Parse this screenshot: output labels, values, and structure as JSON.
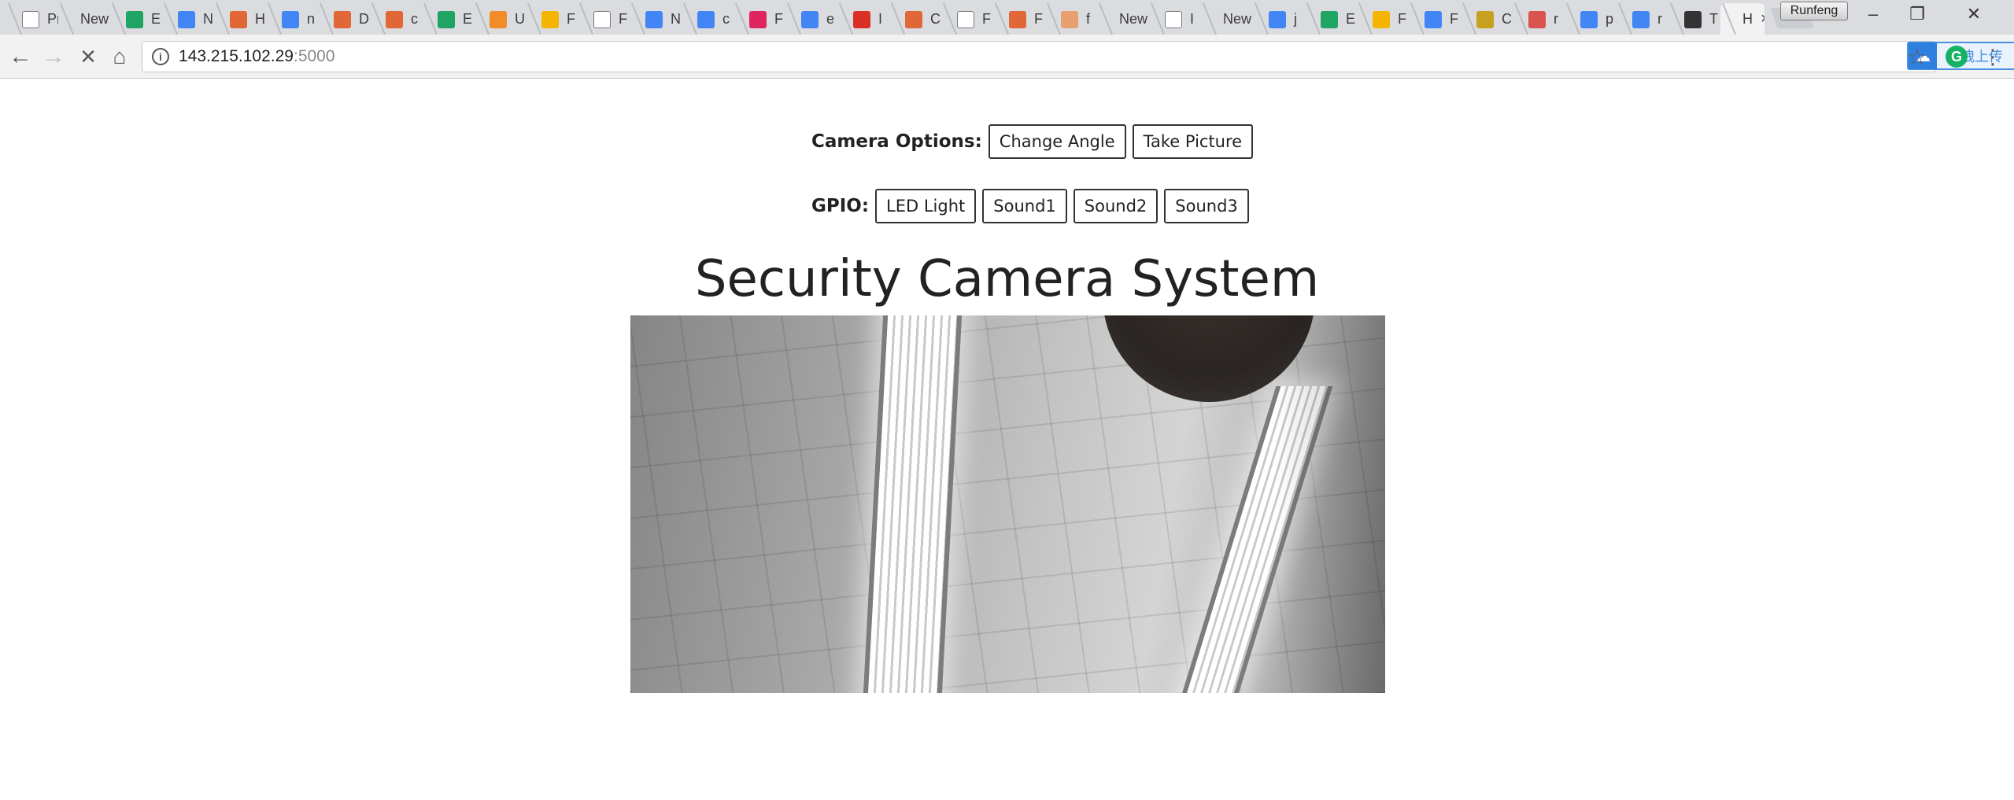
{
  "browser": {
    "tabs": [
      {
        "label": "Priva",
        "icon": "document-icon",
        "color": ""
      },
      {
        "label": "New",
        "icon": "",
        "color": ""
      },
      {
        "label": "E",
        "icon": "google-drive-icon",
        "color": "#1fa463"
      },
      {
        "label": "N",
        "icon": "google-docs-icon",
        "color": "#4285f4"
      },
      {
        "label": "H",
        "icon": "matlab-icon",
        "color": "#e16737"
      },
      {
        "label": "n",
        "icon": "google-icon",
        "color": "#4285f4"
      },
      {
        "label": "D",
        "icon": "matlab-icon",
        "color": "#e16737"
      },
      {
        "label": "c",
        "icon": "matlab-icon",
        "color": "#e16737"
      },
      {
        "label": "E",
        "icon": "google-drive-icon",
        "color": "#1fa463"
      },
      {
        "label": "U",
        "icon": "diagram-icon",
        "color": "#f28c28"
      },
      {
        "label": "F",
        "icon": "google-slides-icon",
        "color": "#f4b400"
      },
      {
        "label": "F",
        "icon": "document-icon",
        "color": ""
      },
      {
        "label": "N",
        "icon": "google-docs-icon",
        "color": "#4285f4"
      },
      {
        "label": "c",
        "icon": "google-icon",
        "color": "#4285f4"
      },
      {
        "label": "F",
        "icon": "heart-icon",
        "color": "#e0245e"
      },
      {
        "label": "e",
        "icon": "google-icon",
        "color": "#4285f4"
      },
      {
        "label": "I",
        "icon": "gmail-icon",
        "color": "#d93025"
      },
      {
        "label": "C",
        "icon": "matlab-icon",
        "color": "#e16737"
      },
      {
        "label": "F",
        "icon": "document-icon",
        "color": ""
      },
      {
        "label": "F",
        "icon": "matlab-icon",
        "color": "#e16737"
      },
      {
        "label": "f",
        "icon": "hand-icon",
        "color": "#e8a070"
      },
      {
        "label": "New",
        "icon": "",
        "color": ""
      },
      {
        "label": "I",
        "icon": "document-icon",
        "color": ""
      },
      {
        "label": "New",
        "icon": "",
        "color": ""
      },
      {
        "label": "j",
        "icon": "google-icon",
        "color": "#4285f4"
      },
      {
        "label": "E",
        "icon": "google-drive-icon",
        "color": "#1fa463"
      },
      {
        "label": "F",
        "icon": "google-slides-icon",
        "color": "#f4b400"
      },
      {
        "label": "F",
        "icon": "google-docs-icon",
        "color": "#4285f4"
      },
      {
        "label": "C",
        "icon": "bee-icon",
        "color": "#c8a020"
      },
      {
        "label": "r",
        "icon": "ampersand-icon",
        "color": "#d9534f"
      },
      {
        "label": "p",
        "icon": "google-icon",
        "color": "#4285f4"
      },
      {
        "label": "r",
        "icon": "google-icon",
        "color": "#4285f4"
      },
      {
        "label": "T",
        "icon": "newspaper-icon",
        "color": "#333333"
      },
      {
        "label": "H",
        "icon": "",
        "color": "",
        "active": true
      }
    ],
    "profile_name": "Runfeng",
    "address": {
      "host": "143.215.102.29",
      "port": ":5000"
    },
    "upload_widget_label": "拖拽上传",
    "grammarly_badge": "G"
  },
  "page": {
    "camera_options_label": "Camera Options:",
    "camera_buttons": [
      "Change Angle",
      "Take Picture"
    ],
    "gpio_label": "GPIO:",
    "gpio_buttons": [
      "LED Light",
      "Sound1",
      "Sound2",
      "Sound3"
    ],
    "title": "Security Camera System"
  }
}
